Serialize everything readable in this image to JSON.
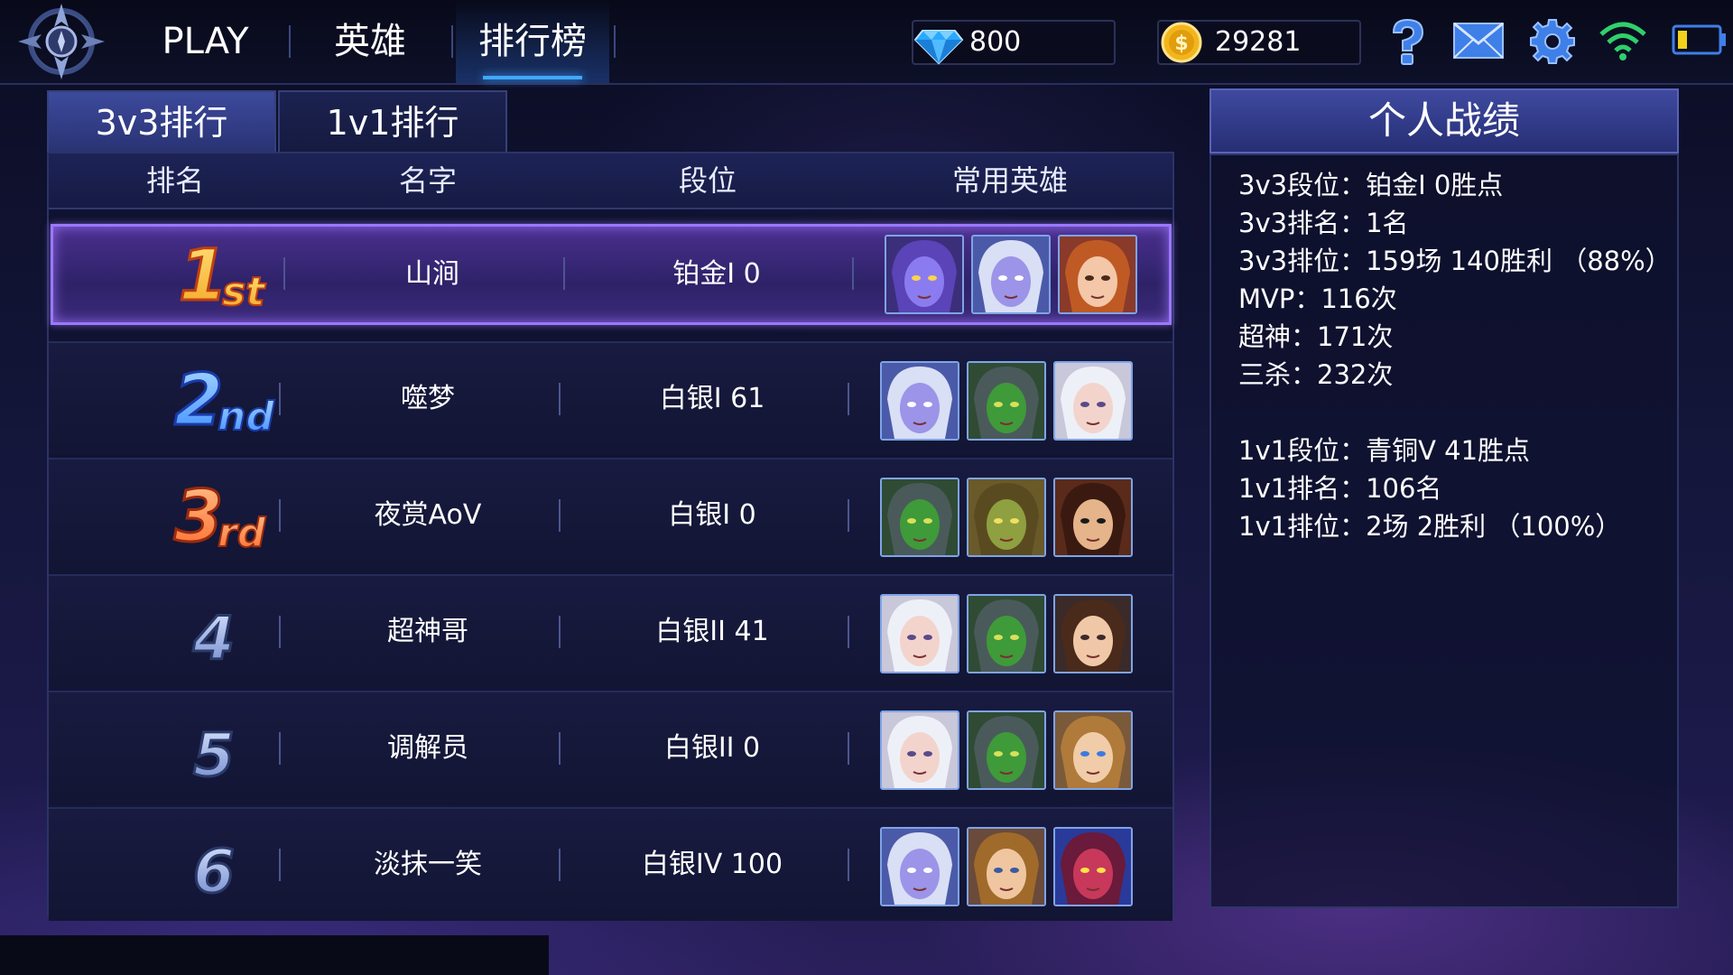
{
  "nav": {
    "items": [
      {
        "label": "PLAY"
      },
      {
        "label": "英雄"
      },
      {
        "label": "排行榜"
      }
    ],
    "active": "排行榜"
  },
  "currency": {
    "diamonds": "800",
    "gold": "29281",
    "diamond_color": "#2aa9ff",
    "gold_color": "#f2b51d"
  },
  "tabs": [
    {
      "label": "3v3排行"
    },
    {
      "label": "1v1排行"
    }
  ],
  "table": {
    "headers": [
      "排名",
      "名字",
      "段位",
      "常用英雄"
    ],
    "rows": [
      {
        "rank": "1st",
        "name": "山涧",
        "tier": "铂金I 0",
        "heroes": [
          "dark-elf-purple-hair",
          "silver-hair-elf",
          "fire-sorceress"
        ]
      },
      {
        "rank": "2nd",
        "name": "噬梦",
        "tier": "白银I 61",
        "heroes": [
          "silver-hair-elf",
          "green-orc",
          "white-hair-woman"
        ]
      },
      {
        "rank": "3rd",
        "name": "夜赏AoV",
        "tier": "白银I 0",
        "heroes": [
          "green-orc",
          "goblin-brute",
          "masked-warrior"
        ]
      },
      {
        "rank": "4",
        "name": "超神哥",
        "tier": "白银II 41",
        "heroes": [
          "white-hair-woman",
          "green-orc",
          "brown-hair-girl"
        ]
      },
      {
        "rank": "5",
        "name": "调解员",
        "tier": "白银II 0",
        "heroes": [
          "white-hair-woman",
          "green-orc",
          "blue-eyed-elf-girl"
        ]
      },
      {
        "rank": "6",
        "name": "淡抹一笑",
        "tier": "白银IV 100",
        "heroes": [
          "silver-hair-elf",
          "elf-archer",
          "red-demon"
        ]
      }
    ]
  },
  "panel": {
    "title": "个人战绩",
    "stats_3v3": [
      "3v3段位：铂金I 0胜点",
      "3v3排名：1名",
      "3v3排位：159场 140胜利 （88%）",
      "MVP：116次",
      "超神：171次",
      "三杀：232次"
    ],
    "stats_1v1": [
      "1v1段位：青铜V 41胜点",
      "1v1排名：106名",
      "1v1排位：2场 2胜利 （100%）"
    ]
  },
  "icons": {
    "logo": "game-crest-icon",
    "help": "help-icon",
    "mail": "mail-icon",
    "settings": "gear-icon",
    "wifi": "wifi-icon",
    "battery": "battery-icon"
  },
  "colors": {
    "accent": "#3fa9ff",
    "highlight_row": "#9a78ff",
    "rank1": "#f5a623",
    "rank2": "#3d8dff",
    "rank3": "#ff6a2b"
  }
}
